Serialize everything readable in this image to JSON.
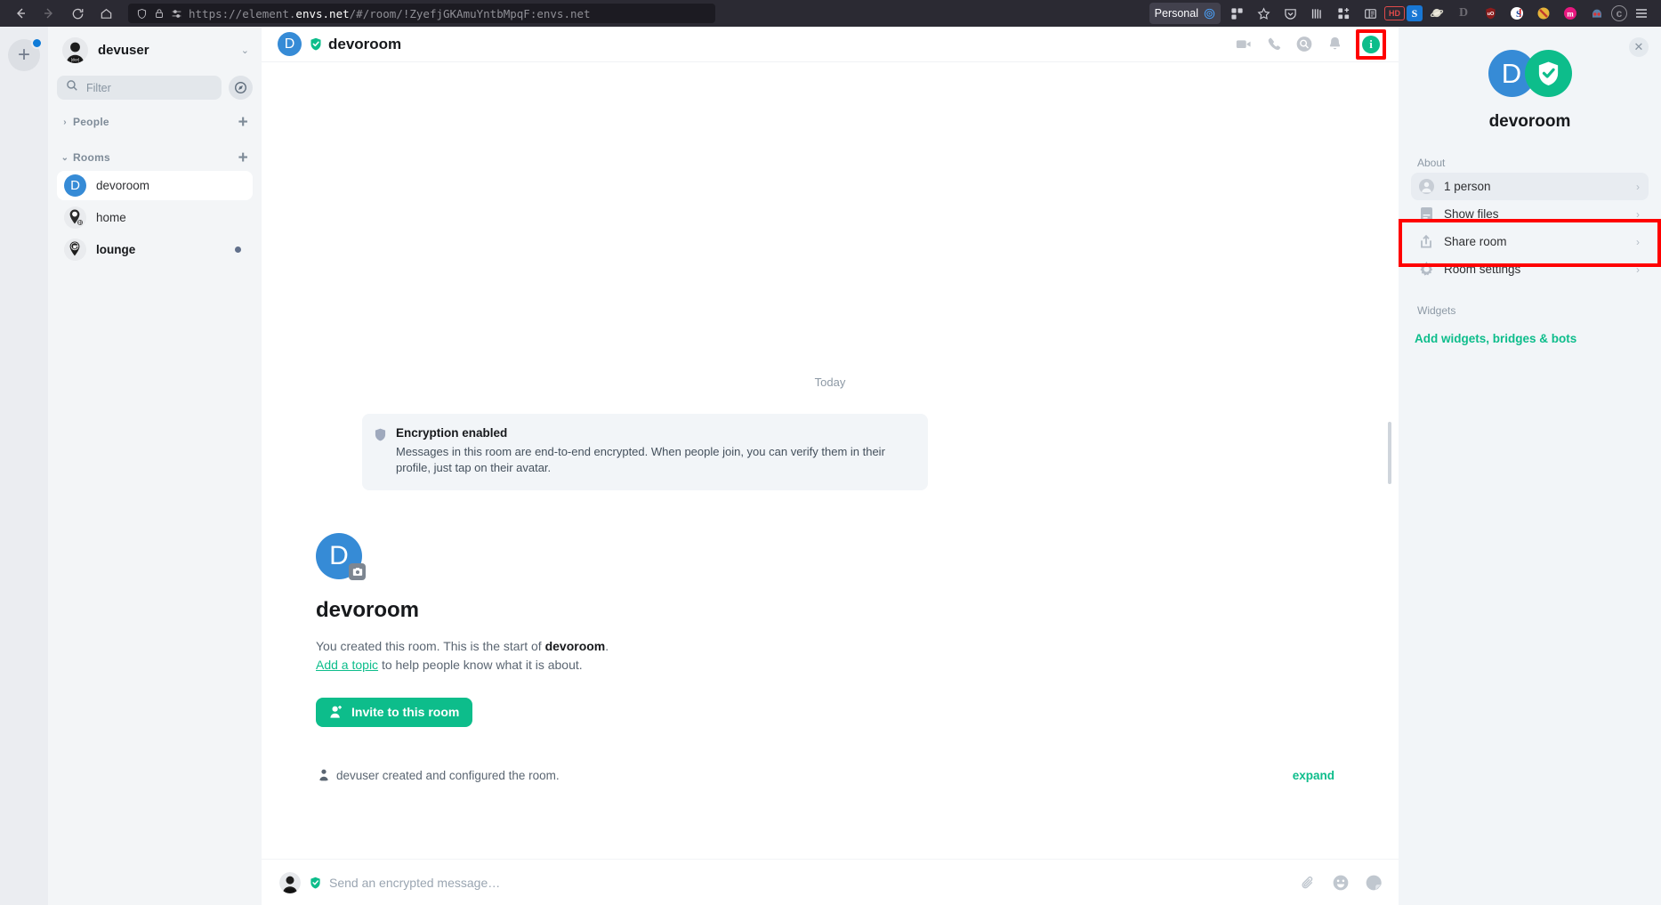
{
  "browser": {
    "url_prefix": "https://element.",
    "url_domain": "envs.net",
    "url_suffix": "/#/room/!ZyefjGKAmuYntbMpqF:envs.net",
    "profile_label": "Personal",
    "back_icon": "back-arrow-icon",
    "forward_icon": "forward-arrow-icon",
    "reload_icon": "reload-icon",
    "home_icon": "home-icon",
    "shield_icon": "shield-icon",
    "lock_icon": "lock-icon",
    "extensions": [
      "pocket-icon",
      "library-icon",
      "extensions-icon",
      "reader-icon",
      "hd-icon",
      "s-icon",
      "planet-icon",
      "d-icon",
      "ublock-icon",
      "sci-icon",
      "noscript-icon",
      "m-icon",
      "face-icon",
      "c-icon",
      "menu-icon"
    ]
  },
  "spaces": {
    "add_label": "+",
    "add_name": "create-space-button"
  },
  "sidebar": {
    "user": {
      "name": "devuser",
      "chevron": "⌄"
    },
    "filter": {
      "placeholder": "Filter",
      "value": ""
    },
    "explore_icon": "compass-icon",
    "sections": [
      {
        "label": "People",
        "caret": "›",
        "expanded": false,
        "add": "+"
      },
      {
        "label": "Rooms",
        "caret": "⌄",
        "expanded": true,
        "add": "+"
      }
    ],
    "rooms": [
      {
        "name": "devoroom",
        "avatar_letter": "D",
        "avatar_type": "letter",
        "active": true,
        "unread": false
      },
      {
        "name": "home",
        "avatar_type": "pin",
        "active": false,
        "unread": false
      },
      {
        "name": "lounge",
        "avatar_type": "pin",
        "active": false,
        "unread": true
      }
    ]
  },
  "room_header": {
    "avatar_letter": "D",
    "title": "devoroom",
    "shield_icon": "verified-shield-icon",
    "actions": [
      {
        "name": "video-call-button",
        "icon": "video-camera-icon"
      },
      {
        "name": "voice-call-button",
        "icon": "phone-icon"
      },
      {
        "name": "search-button",
        "icon": "search-icon"
      },
      {
        "name": "notifications-button",
        "icon": "bell-icon"
      }
    ],
    "info_button": {
      "name": "room-info-button",
      "label": "i",
      "highlighted": true
    }
  },
  "timeline": {
    "date_separator": "Today",
    "encryption": {
      "title": "Encryption enabled",
      "body": "Messages in this room are end-to-end encrypted. When people join, you can verify them in their profile, just tap on their avatar.",
      "icon": "shield-icon"
    },
    "intro": {
      "avatar_letter": "D",
      "camera_icon": "camera-icon",
      "name": "devoroom",
      "line1_pre": "You created this room. This is the start of ",
      "line1_bold": "devoroom",
      "line1_post": ".",
      "line2_link": "Add a topic",
      "line2_rest": " to help people know what it is about.",
      "invite_label": "Invite to this room",
      "invite_icon": "person-add-icon"
    },
    "event": {
      "icon": "user-icon",
      "text": "devuser created and configured the room.",
      "expand_label": "expand"
    }
  },
  "composer": {
    "placeholder": "Send an encrypted message…",
    "value": "",
    "shield_icon": "verified-shield-icon",
    "actions": [
      {
        "name": "attachment-button",
        "icon": "paperclip-icon"
      },
      {
        "name": "emoji-button",
        "icon": "emoji-icon"
      },
      {
        "name": "sticker-button",
        "icon": "sticker-icon"
      }
    ]
  },
  "right_panel": {
    "close_label": "✕",
    "avatar_letter": "D",
    "shield_icon": "verified-shield-icon",
    "title": "devoroom",
    "about_label": "About",
    "rows": [
      {
        "label": "1 person",
        "icon": "person-icon",
        "chevron": "›",
        "highlighted": true
      },
      {
        "label": "Show files",
        "icon": "file-icon",
        "chevron": "›",
        "highlighted": false
      },
      {
        "label": "Share room",
        "icon": "share-icon",
        "chevron": "›",
        "highlighted": false
      },
      {
        "label": "Room settings",
        "icon": "gear-icon",
        "chevron": "›",
        "highlighted": false
      }
    ],
    "widgets_label": "Widgets",
    "widgets_link": "Add widgets, bridges & bots"
  },
  "colors": {
    "accent_green": "#0dbd8b",
    "avatar_blue": "#368bd6",
    "highlight_red": "#ff0000",
    "panel_bg": "#f2f5f8"
  }
}
